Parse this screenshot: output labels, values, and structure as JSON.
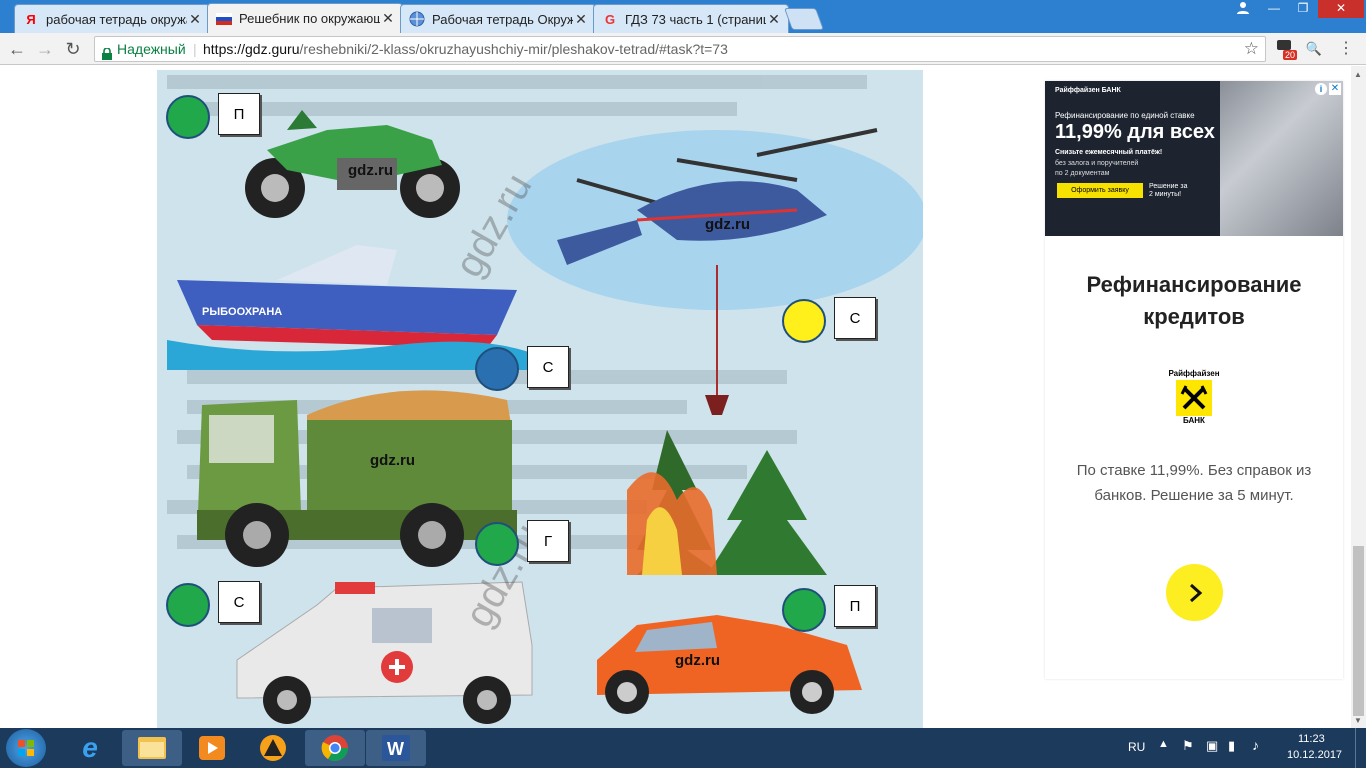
{
  "browser": {
    "tabs": [
      {
        "icon": "yandex-icon",
        "title": "рабочая тетрадь окружа"
      },
      {
        "icon": "ru-flag-icon",
        "title": "Решебник по окружающ"
      },
      {
        "icon": "globe-icon",
        "title": "Рабочая тетрадь Окруж"
      },
      {
        "icon": "gdz-icon",
        "title": "ГДЗ 73 часть 1 (страниц"
      }
    ],
    "secure_label": "Надежный",
    "url_host": "https://gdz.guru",
    "url_path": "/reshebniki/2-klass/okruzhayushchiy-mir/pleshakov-tetrad/#task?t=73",
    "notification_count": "20"
  },
  "exercise": {
    "watermark": "gdz.ru",
    "answers": [
      {
        "vehicle": "motorcycle",
        "letter": "П",
        "dot_color": "#21a84a"
      },
      {
        "vehicle": "helicopter",
        "letter": "С",
        "dot_color": "#ffef1a"
      },
      {
        "vehicle": "boat",
        "letter": "С",
        "dot_color": "#2a6fb0"
      },
      {
        "vehicle": "dump-truck",
        "letter": "Г",
        "dot_color": "#21a84a"
      },
      {
        "vehicle": "ambulance",
        "letter": "С",
        "dot_color": "#21a84a"
      },
      {
        "vehicle": "car",
        "letter": "П",
        "dot_color": "#21a84a"
      }
    ],
    "boat_text": "РЫБООХРАНА"
  },
  "ad": {
    "banner_bank": "Райффайзен БАНК",
    "banner_line1": "Рефинансирование по единой ставке",
    "banner_rate": "11,99% для всех",
    "banner_line2": "Снизьте ежемесячный платёж!",
    "banner_bullet1": "без залога и поручителей",
    "banner_bullet2": "по 2 документам",
    "banner_button": "Оформить заявку",
    "banner_note": "Решение за 2 минуты!",
    "title": "Рефинансирование кредитов",
    "logo_text": "Райффайзен",
    "logo_sub": "БАНК",
    "description": "По ставке 11,99%. Без справок из банков. Решение за 5 минут.",
    "info_icon": "info-icon",
    "close_icon": "close-icon"
  },
  "taskbar": {
    "lang": "RU",
    "time": "11:23",
    "date": "10.12.2017"
  }
}
